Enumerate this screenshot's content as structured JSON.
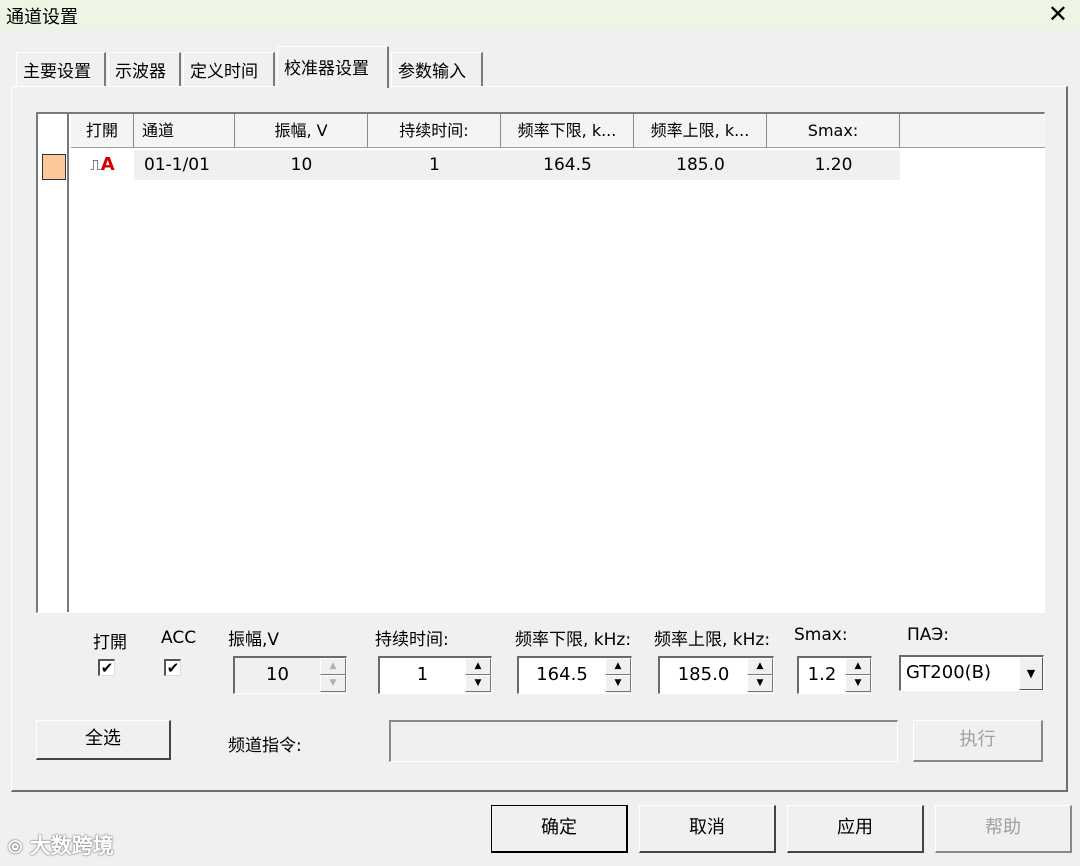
{
  "window": {
    "title": "通道设置",
    "close_glyph": "✕"
  },
  "tabs": [
    {
      "label": "主要设置",
      "active": false
    },
    {
      "label": "示波器",
      "active": false
    },
    {
      "label": "定义时间",
      "active": false
    },
    {
      "label": "校准器设置",
      "active": true
    },
    {
      "label": "参数输入",
      "active": false
    }
  ],
  "table": {
    "columns": [
      "打開",
      "通道",
      "振幅, V",
      "持续时间:",
      "频率下限, k...",
      "频率上限, k...",
      "Smax:"
    ],
    "rows": [
      {
        "signal_icon": "pulse-icon",
        "icon_text": "⎍",
        "icon_mark": "A",
        "channel": "01-1/01",
        "amplitude": "10",
        "duration": "1",
        "freq_low": "164.5",
        "freq_high": "185.0",
        "smax": "1.20",
        "marker_color": "#fcc79b"
      }
    ]
  },
  "controls": {
    "open_label": "打開",
    "open_checked": "✔",
    "acc_label": "ACC",
    "acc_checked": "✔",
    "amplitude_label": "振幅,V",
    "amplitude_value": "10",
    "duration_label": "持续时间:",
    "duration_value": "1",
    "freq_low_label": "频率下限, kHz:",
    "freq_low_value": "164.5",
    "freq_high_label": "频率上限, kHz:",
    "freq_high_value": "185.0",
    "smax_label": "Smax:",
    "smax_value": "1.2",
    "pae_label": "ПАЭ:",
    "pae_value": "GT200(B)",
    "select_all_label": "全选",
    "channel_cmd_label": "频道指令:",
    "channel_cmd_value": "",
    "execute_label": "执行"
  },
  "footer": {
    "ok_label": "确定",
    "cancel_label": "取消",
    "apply_label": "应用",
    "help_label": "帮助"
  },
  "watermark": "大数跨境"
}
